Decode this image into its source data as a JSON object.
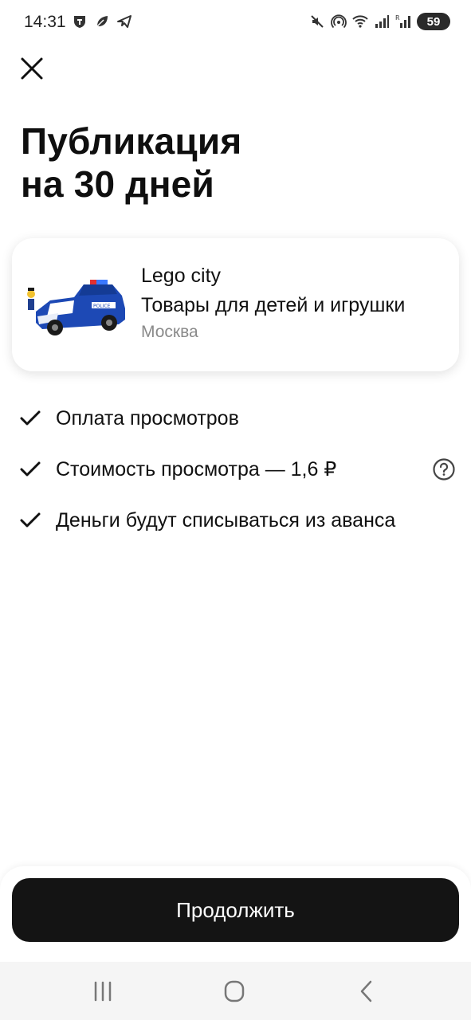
{
  "status_bar": {
    "time": "14:31",
    "battery": "59",
    "left_icons": [
      "shield-icon",
      "leaf-icon",
      "telegram-icon"
    ],
    "right_icons": [
      "mute-icon",
      "hotspot-icon",
      "wifi-icon",
      "signal-icon",
      "signal-roaming-icon"
    ]
  },
  "header": {
    "close_icon": "close-icon",
    "title_line1": "Публикация",
    "title_line2": "на 30 дней"
  },
  "listing": {
    "title": "Lego city",
    "category": "Товары для детей и игрушки",
    "city": "Москва",
    "image": "lego-police-car"
  },
  "features": [
    {
      "text": "Оплата просмотров",
      "icon": "check-icon"
    },
    {
      "text": "Стоимость просмотра — 1,6 ₽",
      "icon": "check-icon",
      "help_icon": "question-icon"
    },
    {
      "text": "Деньги будут списываться из аванса",
      "icon": "check-icon"
    }
  ],
  "footer": {
    "continue_label": "Продолжить"
  },
  "nav_bar": {
    "items": [
      "recent-apps-icon",
      "home-icon",
      "back-icon"
    ]
  },
  "colors": {
    "primary_button": "#141414",
    "secondary_text": "#8a8a8a",
    "background": "#ffffff"
  }
}
